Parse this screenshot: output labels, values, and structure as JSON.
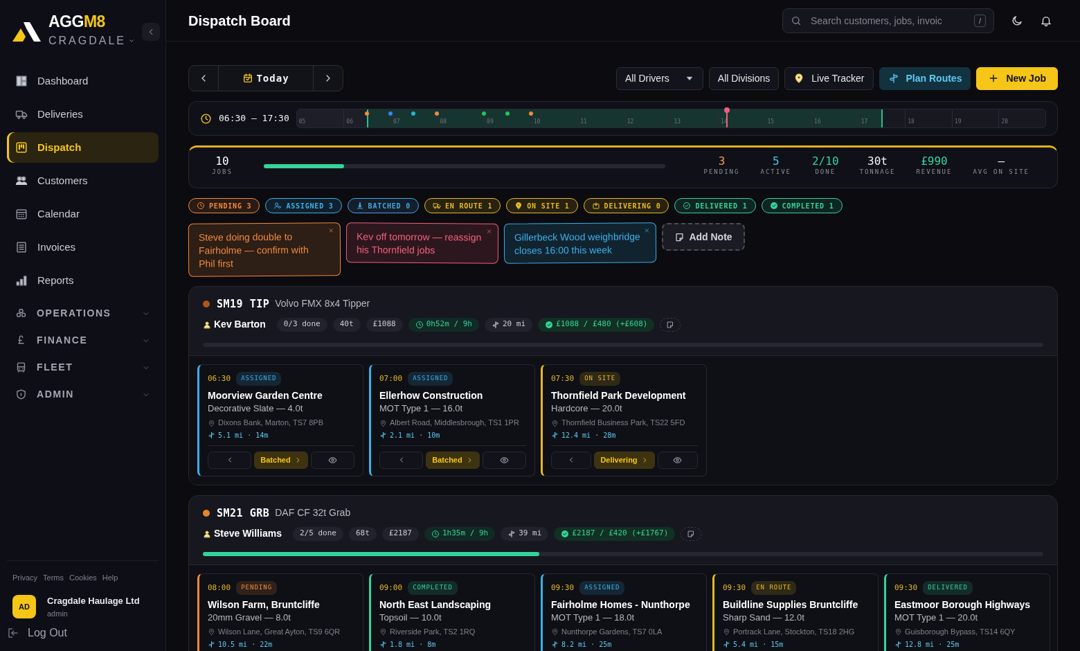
{
  "sidebar": {
    "brand": {
      "prefix": "AGG",
      "suffix": "M8"
    },
    "division": "CRAGDALE",
    "nav": [
      {
        "label": "Dashboard",
        "selected": false
      },
      {
        "label": "Deliveries",
        "selected": false
      },
      {
        "label": "Dispatch",
        "selected": true
      },
      {
        "label": "Customers",
        "selected": false
      },
      {
        "label": "Calendar",
        "selected": false
      },
      {
        "label": "Invoices",
        "selected": false
      },
      {
        "label": "Reports",
        "selected": false
      }
    ],
    "sections": [
      {
        "label": "OPERATIONS",
        "expanded": false
      },
      {
        "label": "FINANCE",
        "expanded": false
      },
      {
        "label": "FLEET",
        "expanded": false
      },
      {
        "label": "ADMIN",
        "expanded": false
      }
    ],
    "footer_links": [
      "Privacy",
      "Terms",
      "Cookies",
      "Help"
    ],
    "user": {
      "initials": "AD",
      "name": "Cragdale Haulage Ltd",
      "role": "admin"
    },
    "logout": "Log Out"
  },
  "header": {
    "title": "Dispatch Board",
    "search": {
      "placeholder": "Search customers, jobs, invoic",
      "shortcut": "/"
    }
  },
  "toolbar": {
    "date": "Today",
    "filters": [
      {
        "label": "All Drivers",
        "kind": "select"
      },
      {
        "label": "All Divisions",
        "kind": "button"
      }
    ],
    "buttons": [
      {
        "label": "Live Tracker",
        "kind": "tracker"
      },
      {
        "label": "Plan Routes",
        "kind": "routes"
      },
      {
        "label": "New Job",
        "kind": "primary"
      }
    ]
  },
  "timeline": {
    "shift": "06:30 – 17:30",
    "hours": [
      "05",
      "06",
      "07",
      "08",
      "09",
      "10",
      "11",
      "12",
      "13",
      "14",
      "15",
      "16",
      "17",
      "18",
      "19",
      "20"
    ],
    "window_start": {
      "level": 0.094
    },
    "window_end": {
      "level": 0.781
    },
    "now": {
      "level": 0.574
    },
    "markers": [
      {
        "level": 0.094,
        "color": "#f08a3c"
      },
      {
        "level": 0.125,
        "color": "#3b82f6"
      },
      {
        "level": 0.156,
        "color": "#22b8cf"
      },
      {
        "level": 0.1875,
        "color": "#f08a3c"
      },
      {
        "level": 0.25,
        "color": "#22c55e"
      },
      {
        "level": 0.281,
        "color": "#22c55e"
      },
      {
        "level": 0.3125,
        "color": "#f08a3c"
      }
    ]
  },
  "stats": {
    "jobs": {
      "value": "10",
      "label": "JOBS",
      "level": 0.2
    },
    "items": [
      {
        "value": "3",
        "label": "PENDING",
        "color": "#f59e42"
      },
      {
        "value": "5",
        "label": "ACTIVE",
        "color": "#4cc3f0"
      },
      {
        "value": "2/10",
        "label": "DONE",
        "color": "#34d399"
      },
      {
        "value": "30t",
        "label": "TONNAGE",
        "color": "#f3f4f6"
      },
      {
        "value": "£990",
        "label": "REVENUE",
        "color": "#34d399"
      },
      {
        "value": "–",
        "label": "AVG ON SITE",
        "color": "#f3f4f6"
      }
    ]
  },
  "status_filters": [
    {
      "label": "PENDING 3",
      "color": "#f08a3c"
    },
    {
      "label": "ASSIGNED 3",
      "color": "#3ab0e8"
    },
    {
      "label": "BATCHED 0",
      "color": "#4aa3e0"
    },
    {
      "label": "EN ROUTE 1",
      "color": "#e8b923"
    },
    {
      "label": "ON SITE 1",
      "color": "#e8b923"
    },
    {
      "label": "DELIVERING 0",
      "color": "#e8b923"
    },
    {
      "label": "DELIVERED 1",
      "color": "#34d399"
    },
    {
      "label": "COMPLETED 1",
      "color": "#34d399"
    }
  ],
  "notes": [
    {
      "text": "Steve doing double to Fairholme — confirm with Phil first",
      "color": "#f08a3c"
    },
    {
      "text": "Kev off tomorrow — reassign his Thornfield jobs",
      "color": "#f0607a"
    },
    {
      "text": "Gillerbeck Wood weighbridge closes 16:00 this week",
      "color": "#3ab0e8"
    }
  ],
  "add_note": "Add Note",
  "vehicles": [
    {
      "reg": "SM19 TIP",
      "model": "Volvo FMX 8x4 Tipper",
      "color": "#b4531a",
      "driver": "Kev Barton",
      "level": 0,
      "chips": [
        {
          "text": "0/3 done",
          "kind": "plain"
        },
        {
          "text": "40t",
          "kind": "plain"
        },
        {
          "text": "£1088",
          "kind": "plain"
        },
        {
          "text": "0h52m / 9h",
          "kind": "time"
        },
        {
          "text": "20 mi",
          "kind": "distance"
        },
        {
          "text": "£1088 / £480 (+£608)",
          "kind": "profit"
        }
      ],
      "jobs": [
        {
          "time": "06:30",
          "status": "ASSIGNED",
          "color": "#3ab0e8",
          "customer": "Moorview Garden Centre",
          "material": "Decorative Slate — 4.0t",
          "address": "Dixons Bank, Marton, TS7 8PB",
          "route": "5.1 mi · 14m",
          "next": "Batched"
        },
        {
          "time": "07:00",
          "status": "ASSIGNED",
          "color": "#3ab0e8",
          "customer": "Ellerhow Construction",
          "material": "MOT Type 1 — 16.0t",
          "address": "Albert Road, Middlesbrough, TS1 1PR",
          "route": "2.1 mi · 10m",
          "next": "Batched"
        },
        {
          "time": "07:30",
          "status": "ON SITE",
          "color": "#e8b923",
          "customer": "Thornfield Park Development",
          "material": "Hardcore — 20.0t",
          "address": "Thornfield Business Park, TS22 5FD",
          "route": "12.4 mi · 28m",
          "next": "Delivering"
        }
      ]
    },
    {
      "reg": "SM21 GRB",
      "model": "DAF CF 32t Grab",
      "color": "#e8862a",
      "driver": "Steve Williams",
      "level": 0.4,
      "chips": [
        {
          "text": "2/5 done",
          "kind": "plain"
        },
        {
          "text": "68t",
          "kind": "plain"
        },
        {
          "text": "£2187",
          "kind": "plain"
        },
        {
          "text": "1h35m / 9h",
          "kind": "time"
        },
        {
          "text": "39 mi",
          "kind": "distance"
        },
        {
          "text": "£2187 / £420 (+£1767)",
          "kind": "profit"
        }
      ],
      "jobs": [
        {
          "time": "08:00",
          "status": "PENDING",
          "color": "#f08a3c",
          "customer": "Wilson Farm, Bruntcliffe",
          "material": "20mm Gravel — 8.0t",
          "address": "Wilson Lane, Great Ayton, TS9 6QR",
          "route": "10.5 mi · 22m"
        },
        {
          "time": "09:00",
          "status": "COMPLETED",
          "color": "#34d399",
          "customer": "North East Landscaping",
          "material": "Topsoil — 10.0t",
          "address": "Riverside Park, TS2 1RQ",
          "route": "1.8 mi · 8m"
        },
        {
          "time": "09:30",
          "status": "ASSIGNED",
          "color": "#3ab0e8",
          "customer": "Fairholme Homes - Nunthorpe",
          "material": "MOT Type 1 — 18.0t",
          "address": "Nunthorpe Gardens, TS7 0LA",
          "route": "8.2 mi · 25m"
        },
        {
          "time": "09:30",
          "status": "EN ROUTE",
          "color": "#e8b923",
          "customer": "Buildline Supplies Bruntcliffe",
          "material": "Sharp Sand — 12.0t",
          "address": "Portrack Lane, Stockton, TS18 2HG",
          "route": "5.4 mi · 15m"
        },
        {
          "time": "09:30",
          "status": "DELIVERED",
          "color": "#34d399",
          "customer": "Eastmoor Borough Highways",
          "material": "MOT Type 1 — 20.0t",
          "address": "Guisborough Bypass, TS14 6QY",
          "route": "12.8 mi · 25m"
        }
      ]
    }
  ]
}
